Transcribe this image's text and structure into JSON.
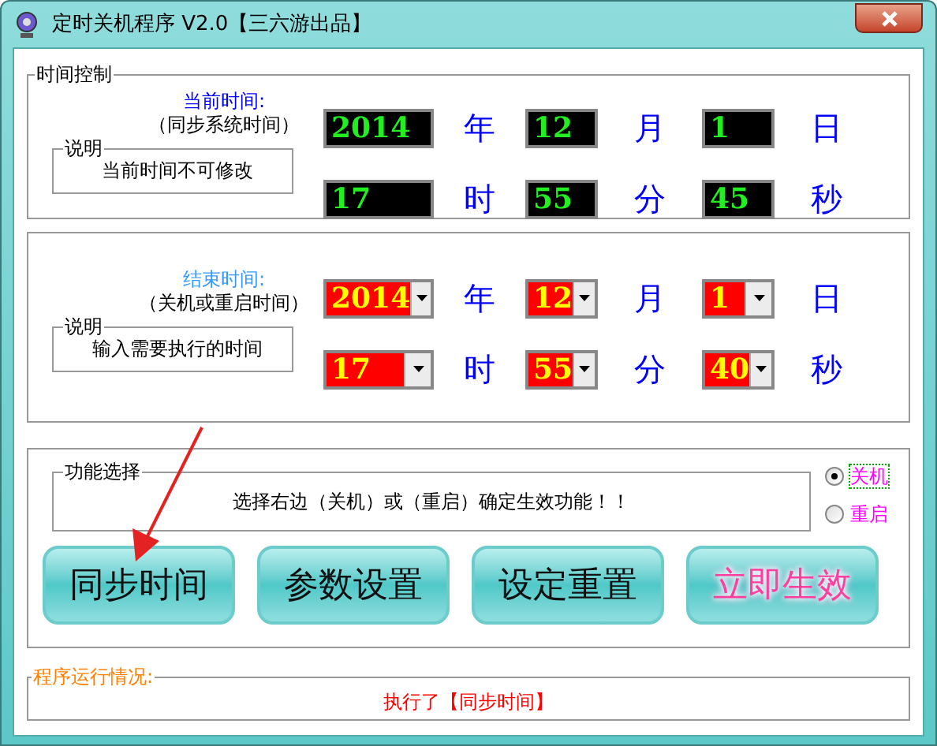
{
  "window": {
    "title": "定时关机程序 V2.0【三六游出品】"
  },
  "time_control": {
    "title": "时间控制",
    "heading": "当前时间:",
    "subheading": "（同步系统时间）",
    "note_title": "说明",
    "note": "当前时间不可修改",
    "fields": [
      {
        "value": "2014",
        "unit": "年"
      },
      {
        "value": "12",
        "unit": "月"
      },
      {
        "value": "1",
        "unit": "日"
      },
      {
        "value": "17",
        "unit": "时"
      },
      {
        "value": "55",
        "unit": "分"
      },
      {
        "value": "45",
        "unit": "秒"
      }
    ]
  },
  "end_time": {
    "heading": "结束时间:",
    "subheading": "（关机或重启时间）",
    "note_title": "说明",
    "note": "输入需要执行的时间",
    "fields": [
      {
        "value": "2014",
        "unit": "年"
      },
      {
        "value": "12",
        "unit": "月"
      },
      {
        "value": "1",
        "unit": "日"
      },
      {
        "value": "17",
        "unit": "时"
      },
      {
        "value": "55",
        "unit": "分"
      },
      {
        "value": "40",
        "unit": "秒"
      }
    ]
  },
  "function_select": {
    "title": "功能选择",
    "hint": "选择右边（关机）或（重启）确定生效功能！！",
    "options": [
      {
        "label": "关机",
        "selected": true
      },
      {
        "label": "重启",
        "selected": false
      }
    ]
  },
  "buttons": [
    {
      "label": "同步时间",
      "kind": "plain"
    },
    {
      "label": "参数设置",
      "kind": "plain"
    },
    {
      "label": "设定重置",
      "kind": "plain"
    },
    {
      "label": "立即生效",
      "kind": "glow"
    }
  ],
  "status": {
    "title": "程序运行情况:",
    "message": "执行了【同步时间】"
  }
}
